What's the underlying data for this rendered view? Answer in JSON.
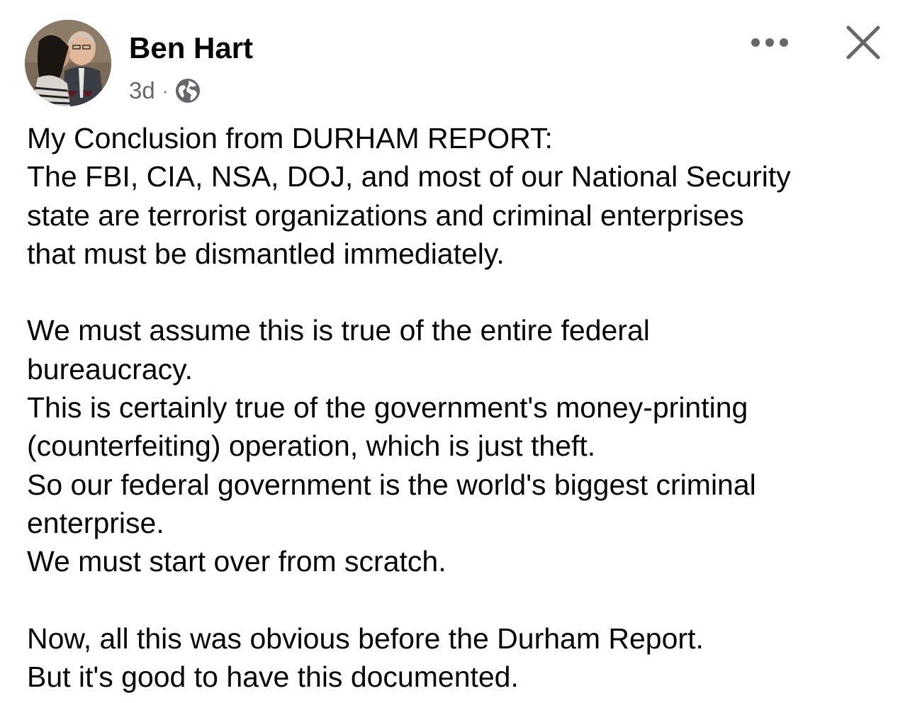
{
  "post": {
    "author": "Ben Hart",
    "timestamp": "3d",
    "separator": "·",
    "audience_icon": "globe-icon",
    "menu_icon": "more-horizontal-icon",
    "close_icon": "close-icon",
    "lines": [
      "My Conclusion from DURHAM REPORT:",
      "The FBI, CIA, NSA, DOJ, and most of our National Security",
      "state are terrorist organizations and criminal enterprises",
      "that must be dismantled immediately.",
      "",
      "We must assume this is true of the entire federal",
      "bureaucracy.",
      "This is certainly true of the government's money-printing",
      "(counterfeiting) operation, which is just theft.",
      "So our federal government is the world's biggest criminal",
      "enterprise.",
      "We must start over from scratch.",
      "",
      "Now, all this was obvious before the Durham Report.",
      "But it's good to have this documented."
    ]
  },
  "colors": {
    "text": "#050505",
    "secondary_text": "#65676b",
    "icon": "#65676b",
    "background": "#ffffff"
  }
}
